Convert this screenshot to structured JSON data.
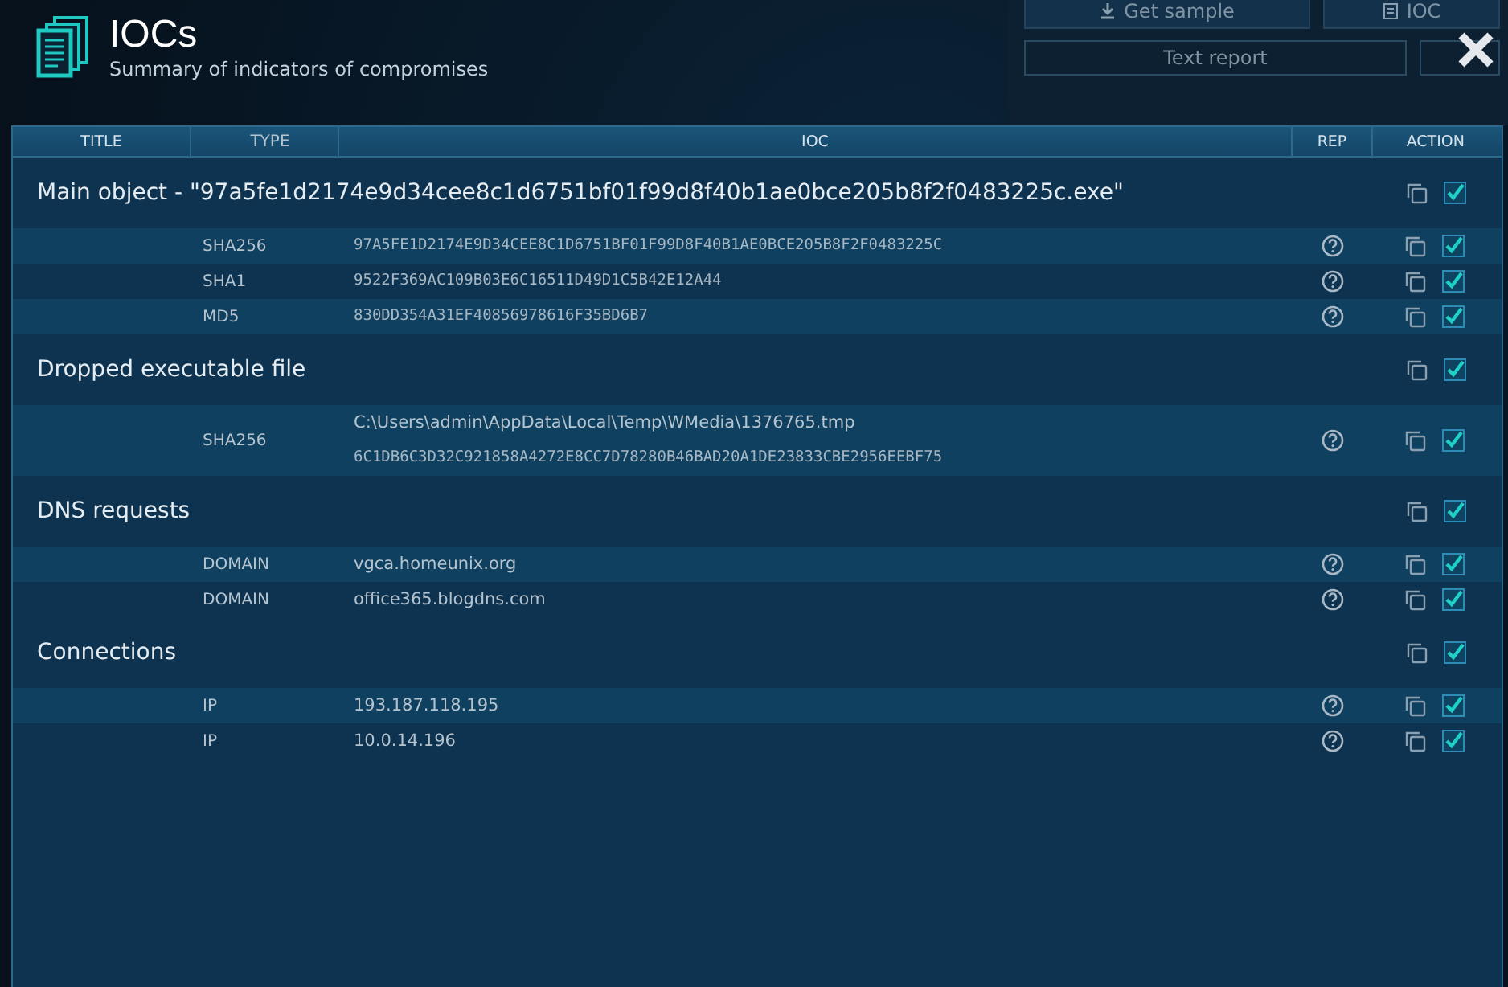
{
  "background_buttons": [
    {
      "label": "Get sample",
      "kind": "download"
    },
    {
      "label": "IOC",
      "kind": "document"
    }
  ],
  "text_report": {
    "label": "Text report"
  },
  "header": {
    "title": "IOCs",
    "subtitle": "Summary of indicators of compromises"
  },
  "table": {
    "columns": [
      "TITLE",
      "TYPE",
      "IOC",
      "REP",
      "ACTION"
    ],
    "groups": [
      {
        "title": "Main object - \"97a5fe1d2174e9d34cee8c1d6751bf01f99d8f40b1ae0bce205b8f2f0483225c.exe\"",
        "checked": true,
        "items": [
          {
            "type": "SHA256",
            "values": [
              {
                "text": "97A5FE1D2174E9D34CEE8C1D6751BF01F99D8F40B1AE0BCE205B8F2F0483225C",
                "kind": "hash"
              }
            ],
            "checked": true
          },
          {
            "type": "SHA1",
            "values": [
              {
                "text": "9522F369AC109B03E6C16511D49D1C5B42E12A44",
                "kind": "hash"
              }
            ],
            "checked": true
          },
          {
            "type": "MD5",
            "values": [
              {
                "text": "830DD354A31EF40856978616F35BD6B7",
                "kind": "hash"
              }
            ],
            "checked": true
          }
        ]
      },
      {
        "title": "Dropped executable file",
        "checked": true,
        "items": [
          {
            "type": "SHA256",
            "values": [
              {
                "text": "C:\\Users\\admin\\AppData\\Local\\Temp\\WMedia\\1376765.tmp",
                "kind": "text"
              },
              {
                "text": "6C1DB6C3D32C921858A4272E8CC7D78280B46BAD20A1DE23833CBE2956EEBF75",
                "kind": "hash"
              }
            ],
            "checked": true
          }
        ]
      },
      {
        "title": "DNS requests",
        "checked": true,
        "items": [
          {
            "type": "DOMAIN",
            "values": [
              {
                "text": "vgca.homeunix.org",
                "kind": "text"
              }
            ],
            "checked": true
          },
          {
            "type": "DOMAIN",
            "values": [
              {
                "text": "office365.blogdns.com",
                "kind": "text"
              }
            ],
            "checked": true
          }
        ]
      },
      {
        "title": "Connections",
        "checked": true,
        "items": [
          {
            "type": "IP",
            "values": [
              {
                "text": "193.187.118.195",
                "kind": "text"
              }
            ],
            "checked": true
          },
          {
            "type": "IP",
            "values": [
              {
                "text": "10.0.14.196",
                "kind": "text"
              }
            ],
            "checked": true
          }
        ]
      }
    ]
  }
}
